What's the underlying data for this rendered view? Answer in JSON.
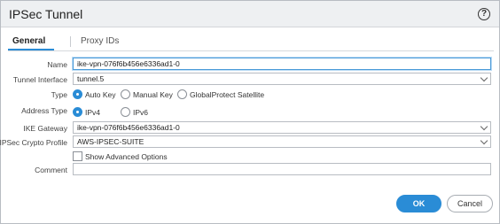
{
  "dialog": {
    "title": "IPSec Tunnel"
  },
  "tabs": [
    {
      "label": "General",
      "active": true
    },
    {
      "label": "Proxy IDs",
      "active": false
    }
  ],
  "fields": {
    "name": {
      "label": "Name",
      "value": "ike-vpn-076f6b456e6336ad1-0"
    },
    "tunnel_interface": {
      "label": "Tunnel Interface",
      "value": "tunnel.5"
    },
    "type": {
      "label": "Type",
      "options": [
        "Auto Key",
        "Manual Key",
        "GlobalProtect Satellite"
      ],
      "selected": "Auto Key"
    },
    "address_type": {
      "label": "Address Type",
      "options": [
        "IPv4",
        "IPv6"
      ],
      "selected": "IPv4"
    },
    "ike_gateway": {
      "label": "IKE Gateway",
      "value": "ike-vpn-076f6b456e6336ad1-0"
    },
    "ipsec_crypto_profile": {
      "label": "IPSec Crypto Profile",
      "value": "AWS-IPSEC-SUITE"
    },
    "show_advanced": {
      "label": "Show Advanced Options",
      "checked": false
    },
    "comment": {
      "label": "Comment",
      "value": ""
    }
  },
  "buttons": {
    "ok": "OK",
    "cancel": "Cancel"
  },
  "colors": {
    "accent": "#2a8cd6",
    "title_bar": "#eef0f2"
  }
}
